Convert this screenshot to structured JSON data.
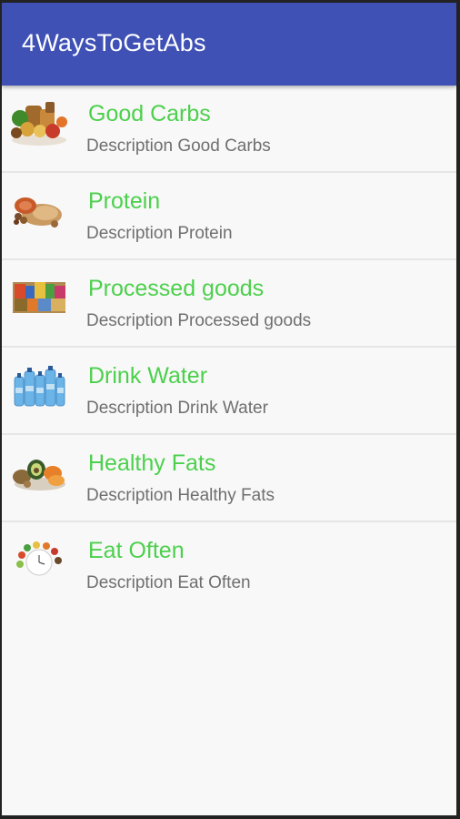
{
  "app_bar": {
    "title": "4WaysToGetAbs",
    "color": "#3f51b5"
  },
  "accent_colors": {
    "item_title": "#4cd04c",
    "item_desc": "#6f6f6f"
  },
  "items": [
    {
      "title": "Good Carbs",
      "description": "Description Good Carbs",
      "icon": "carbs-food-icon"
    },
    {
      "title": "Protein",
      "description": "Description Protein",
      "icon": "protein-food-icon"
    },
    {
      "title": "Processed goods",
      "description": "Description Processed goods",
      "icon": "processed-goods-icon"
    },
    {
      "title": "Drink Water",
      "description": "Description Drink Water",
      "icon": "water-bottles-icon"
    },
    {
      "title": "Healthy Fats",
      "description": "Description Healthy Fats",
      "icon": "healthy-fats-icon"
    },
    {
      "title": "Eat Often",
      "description": "Description Eat Often",
      "icon": "eat-often-icon"
    }
  ]
}
